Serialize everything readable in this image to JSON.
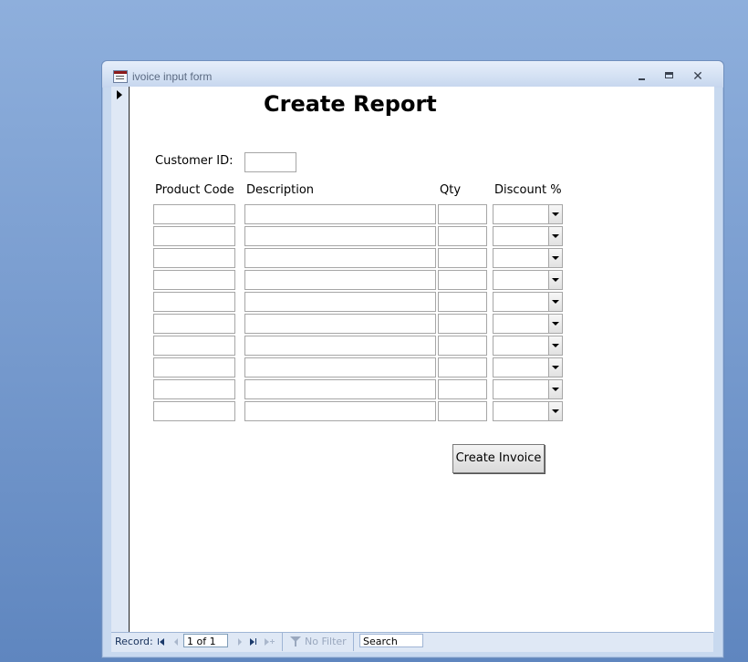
{
  "window": {
    "title": "ivoice input form",
    "controls": {
      "minimize": "minimize-icon",
      "maximize": "maximize-icon",
      "close": "close-icon"
    }
  },
  "form": {
    "title": "Create Report",
    "customer_id_label": "Customer ID:",
    "customer_id_value": "",
    "columns": [
      "Product Code",
      "Description",
      "Qty",
      "Discount %"
    ],
    "row_count": 10,
    "create_invoice_label": "Create Invoice"
  },
  "navigation": {
    "record_label": "Record:",
    "position": "1 of 1",
    "filter_label": "No Filter",
    "search_label": "Search"
  },
  "colors": {
    "desktop": "#7c9fd1",
    "frame": "#c8d9ef",
    "form_background": "#ffffff"
  }
}
